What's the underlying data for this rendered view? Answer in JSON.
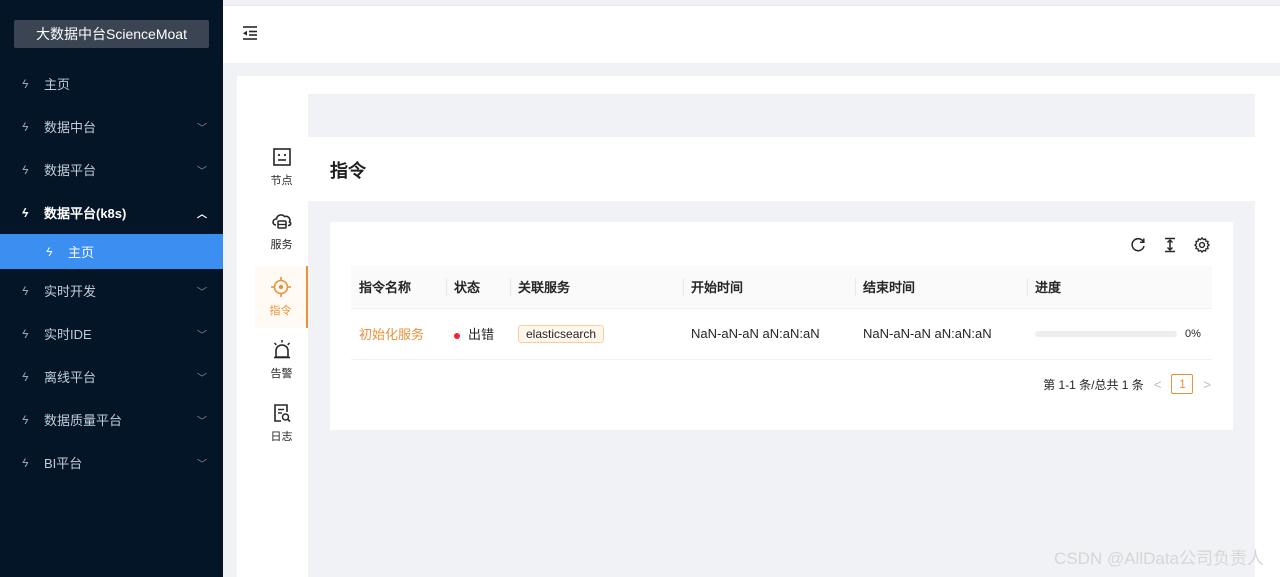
{
  "app": {
    "logo_text": "大数据中台ScienceMoat"
  },
  "sidebar": {
    "items": [
      {
        "label": "主页",
        "chevron": ""
      },
      {
        "label": "数据中台",
        "chevron": "﹀"
      },
      {
        "label": "数据平台",
        "chevron": "﹀"
      },
      {
        "label": "数据平台(k8s)",
        "chevron": "︿"
      },
      {
        "label": "主页",
        "chevron": ""
      },
      {
        "label": "实时开发",
        "chevron": "﹀"
      },
      {
        "label": "实时IDE",
        "chevron": "﹀"
      },
      {
        "label": "离线平台",
        "chevron": "﹀"
      },
      {
        "label": "数据质量平台",
        "chevron": "﹀"
      },
      {
        "label": "BI平台",
        "chevron": "﹀"
      }
    ],
    "item_icon": "ϟ"
  },
  "side_tabs": [
    {
      "label": "节点",
      "icon": "node-icon"
    },
    {
      "label": "服务",
      "icon": "service-cloud-icon"
    },
    {
      "label": "指令",
      "icon": "command-target-icon"
    },
    {
      "label": "告警",
      "icon": "alarm-icon"
    },
    {
      "label": "日志",
      "icon": "log-file-icon"
    }
  ],
  "page": {
    "title": "指令"
  },
  "table": {
    "columns": [
      "指令名称",
      "状态",
      "关联服务",
      "开始时间",
      "结束时间",
      "进度"
    ],
    "rows": [
      {
        "name": "初始化服务",
        "status": "出错",
        "service": "elasticsearch",
        "start": "NaN-aN-aN aN:aN:aN",
        "end": "NaN-aN-aN aN:aN:aN",
        "progress": 0,
        "progress_text": "0%"
      }
    ]
  },
  "pagination": {
    "summary": "第 1-1 条/总共 1 条",
    "prev": "<",
    "current": "1",
    "next": ">"
  },
  "watermark": "CSDN @AllData公司负责人",
  "colors": {
    "accent": "#e8923b",
    "sidebar_bg": "#041527",
    "active_menu": "#3b8ff0",
    "error": "#f5222d"
  }
}
